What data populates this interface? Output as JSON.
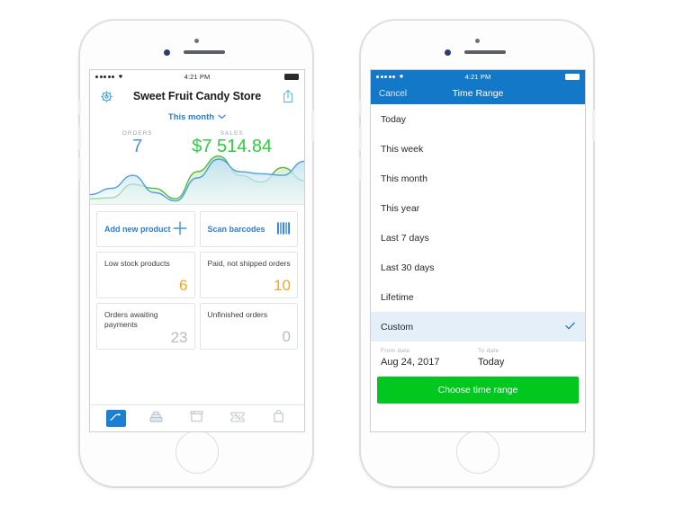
{
  "left_phone": {
    "status_bar": {
      "time": "4:21 PM",
      "signal_dots": 5,
      "wifi_icon": "wifi-icon",
      "battery_icon": "battery-full-icon"
    },
    "navbar": {
      "settings_icon": "gear-icon",
      "title": "Sweet Fruit Candy Store",
      "share_icon": "share-icon"
    },
    "period_selector": {
      "label": "This month",
      "chevron_icon": "chevron-down-icon"
    },
    "stats": [
      {
        "label": "ORDERS",
        "value": "7",
        "color": "#4a90d9"
      },
      {
        "label": "SALES",
        "value": "$7 514.84",
        "color": "#2ecc40"
      }
    ],
    "action_cards": [
      {
        "label": "Add new product",
        "icon": "plus-icon"
      },
      {
        "label": "Scan barcodes",
        "icon": "barcode-icon"
      }
    ],
    "metric_cards": [
      {
        "label": "Low stock products",
        "value": "6",
        "value_color": "#f5a623"
      },
      {
        "label": "Paid, not shipped orders",
        "value": "10",
        "value_color": "#f5a623"
      },
      {
        "label": "Orders awaiting payments",
        "value": "23",
        "value_color": "#b4bcc4"
      },
      {
        "label": "Unfinished orders",
        "value": "0",
        "value_color": "#b4bcc4"
      }
    ],
    "tabbar": [
      {
        "icon": "dashboard-chart-icon",
        "active": true
      },
      {
        "icon": "cash-register-icon",
        "active": false
      },
      {
        "icon": "box-icon",
        "active": false
      },
      {
        "icon": "discount-ticket-icon",
        "active": false
      },
      {
        "icon": "shopping-bag-icon",
        "active": false
      }
    ]
  },
  "right_phone": {
    "status_bar": {
      "time": "4:21 PM",
      "signal_dots": 5,
      "wifi_icon": "wifi-icon",
      "battery_icon": "battery-full-icon"
    },
    "header": {
      "cancel_label": "Cancel",
      "title": "Time Range"
    },
    "options": [
      {
        "label": "Today",
        "selected": false
      },
      {
        "label": "This week",
        "selected": false
      },
      {
        "label": "This month",
        "selected": false
      },
      {
        "label": "This year",
        "selected": false
      },
      {
        "label": "Last 7 days",
        "selected": false
      },
      {
        "label": "Last 30 days",
        "selected": false
      },
      {
        "label": "Lifetime",
        "selected": false
      },
      {
        "label": "Custom",
        "selected": true,
        "check_icon": "checkmark-icon"
      }
    ],
    "date_fields": [
      {
        "label": "From date",
        "value": "Aug 24, 2017"
      },
      {
        "label": "To date",
        "value": "Today"
      }
    ],
    "cta": {
      "label": "Choose time range",
      "color": "#00c81e"
    }
  },
  "chart_data": {
    "type": "area",
    "title": "",
    "xlabel": "",
    "ylabel": "",
    "grid": false,
    "legend": "none",
    "x": [
      0,
      1,
      2,
      3,
      4,
      5,
      6,
      7,
      8,
      9,
      10
    ],
    "series": [
      {
        "name": "Sales",
        "color": "#4cb944",
        "fill": "#e8f4e0",
        "values": [
          0.1,
          0.12,
          0.38,
          0.3,
          0.1,
          0.62,
          0.92,
          0.55,
          0.42,
          0.7,
          0.45
        ]
      },
      {
        "name": "Orders",
        "color": "#4a9fe0",
        "fill": "#dceefb",
        "values": [
          0.18,
          0.3,
          0.55,
          0.22,
          0.06,
          0.5,
          0.86,
          0.62,
          0.58,
          0.55,
          0.82
        ]
      }
    ],
    "ylim": [
      0,
      1
    ]
  }
}
